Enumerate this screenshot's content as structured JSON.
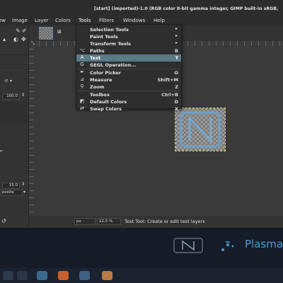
{
  "window": {
    "title": "[start] (imported)-1.0 (RGB color 8-bit gamma integer, GIMP built-in sRGB,"
  },
  "menubar": {
    "items": [
      "ew",
      "Image",
      "Layer",
      "Colors",
      "Tools",
      "Filters",
      "Windows",
      "Help"
    ]
  },
  "tools_menu": {
    "items": [
      {
        "label": "Selection Tools",
        "shortcut": "",
        "icon": "none",
        "submenu": true
      },
      {
        "label": "Paint Tools",
        "shortcut": "",
        "icon": "none",
        "submenu": true
      },
      {
        "label": "Transform Tools",
        "shortcut": "",
        "icon": "none",
        "submenu": true
      },
      {
        "label": "Paths",
        "shortcut": "B",
        "icon": "paths-icon",
        "submenu": false
      },
      {
        "label": "Text",
        "shortcut": "T",
        "icon": "text-icon",
        "submenu": false
      },
      {
        "label": "GEGL Operation...",
        "shortcut": "",
        "icon": "gegl-icon",
        "submenu": false
      },
      {
        "label": "Color Picker",
        "shortcut": "O",
        "icon": "color-picker-icon",
        "submenu": false
      },
      {
        "label": "Measure",
        "shortcut": "Shift+M",
        "icon": "measure-icon",
        "submenu": false
      },
      {
        "label": "Zoom",
        "shortcut": "Z",
        "icon": "zoom-icon",
        "submenu": false
      },
      {
        "label": "Toolbox",
        "shortcut": "Ctrl+B",
        "icon": "none",
        "submenu": false
      },
      {
        "label": "Default Colors",
        "shortcut": "D",
        "icon": "default-colors-icon",
        "submenu": false
      },
      {
        "label": "Swap Colors",
        "shortcut": "X",
        "icon": "swap-colors-icon",
        "submenu": false
      }
    ],
    "highlighted": "Text"
  },
  "left_dock": {
    "opacity_value": "100.0",
    "size_value": "15.0",
    "mode_value": "posite"
  },
  "status_bar": {
    "unit": "px",
    "zoom": "12.5 %",
    "message": "Text Tool: Create or edit text layers"
  },
  "desktop": {
    "brand_text": "Plasma"
  },
  "colors": {
    "highlight": "#5a7a86",
    "plasma_blue": "#4d9ad4"
  }
}
